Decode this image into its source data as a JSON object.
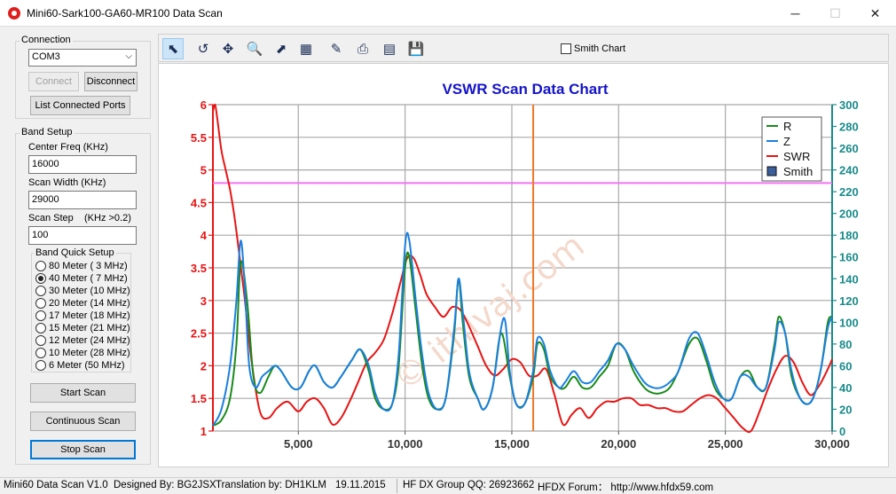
{
  "window": {
    "title": "Mini60-Sark100-GA60-MR100 Data Scan",
    "min_glyph": "─",
    "max_glyph": "☐",
    "close_glyph": "✕"
  },
  "connection": {
    "label": "Connection",
    "port_value": "COM3",
    "connect_label": "Connect",
    "disconnect_label": "Disconnect",
    "list_ports_label": "List Connected Ports"
  },
  "band_setup": {
    "label": "Band Setup",
    "center_freq_label": "Center Freq  (KHz)",
    "center_freq_value": "16000",
    "scan_width_label": "Scan Width   (KHz)",
    "scan_width_value": "29000",
    "scan_step_label": "Scan Step",
    "scan_step_hint": "(KHz >0.2)",
    "scan_step_value": "100",
    "quick_setup_label": "Band Quick Setup",
    "bands": [
      {
        "label": "80 Meter  (  3 MHz)",
        "checked": false
      },
      {
        "label": "40 Meter  (  7 MHz)",
        "checked": true
      },
      {
        "label": "30 Meter  (10 MHz)",
        "checked": false
      },
      {
        "label": "20 Meter  (14 MHz)",
        "checked": false
      },
      {
        "label": "17 Meter  (18 MHz)",
        "checked": false
      },
      {
        "label": "15 Meter  (21 MHz)",
        "checked": false
      },
      {
        "label": "12 Meter  (24 MHz)",
        "checked": false
      },
      {
        "label": "10 Meter  (28 MHz)",
        "checked": false
      },
      {
        "label": "6 Meter   (50 MHz)",
        "checked": false
      }
    ]
  },
  "actions": {
    "start_label": "Start Scan",
    "continuous_label": "Continuous Scan",
    "stop_label": "Stop Scan"
  },
  "toolbar": {
    "tools": [
      {
        "name": "pointer-tool-icon",
        "glyph": "⬉",
        "active": true
      },
      {
        "name": "reset-zoom-icon",
        "glyph": "↺",
        "active": false
      },
      {
        "name": "pan-icon",
        "glyph": "✥",
        "active": false
      },
      {
        "name": "zoom-icon",
        "glyph": "🔍",
        "active": false
      },
      {
        "name": "export-image-icon",
        "glyph": "⬈",
        "active": false
      },
      {
        "name": "chart-settings-icon",
        "glyph": "▦",
        "active": false
      },
      {
        "name": "properties-icon",
        "glyph": "✎",
        "active": false
      },
      {
        "name": "print-icon",
        "glyph": "⎙",
        "active": false
      },
      {
        "name": "print-preview-icon",
        "glyph": "▤",
        "active": false
      },
      {
        "name": "save-icon",
        "glyph": "💾",
        "active": false
      }
    ],
    "smith_chart_label": "Smith Chart"
  },
  "chart_data": {
    "type": "line",
    "title": "VSWR Scan Data Chart",
    "xlim": [
      1000,
      30000
    ],
    "x_ticks": [
      5000,
      10000,
      15000,
      20000,
      25000,
      30000
    ],
    "x_tick_labels": [
      "5,000",
      "10,000",
      "15,000",
      "20,000",
      "25,000",
      "30,000"
    ],
    "y_left_lim": [
      1,
      6
    ],
    "y_left_ticks": [
      1,
      1.5,
      2,
      2.5,
      3,
      3.5,
      4,
      4.5,
      5,
      5.5,
      6
    ],
    "y_right_lim": [
      0,
      300
    ],
    "y_right_ticks": [
      0,
      20,
      40,
      60,
      80,
      100,
      120,
      140,
      160,
      180,
      200,
      220,
      240,
      260,
      280,
      300
    ],
    "grid": true,
    "legend_position": "top-right",
    "legend": [
      "R",
      "Z",
      "SWR",
      "Smith"
    ],
    "colors": {
      "R": "#1a8a1a",
      "Z": "#1a7fe0",
      "SWR": "#e81414",
      "marker": "#f0782a",
      "ref": "#f075f0",
      "left_axis": "#e81414",
      "right_axis": "#1a8a8a",
      "title": "#1414c8"
    },
    "swr_reference": 4.8,
    "marker_x": 16000,
    "watermark": "© ithlvaj.com",
    "series": [
      {
        "name": "R",
        "axis": "right",
        "x": [
          1000,
          1400,
          1800,
          2100,
          2300,
          2600,
          2900,
          3200,
          3600,
          3900,
          4200,
          4700,
          5100,
          5500,
          5800,
          6200,
          6600,
          7000,
          7500,
          7900,
          8300,
          8600,
          9000,
          9400,
          9700,
          10000,
          10200,
          10500,
          10800,
          11100,
          11500,
          11900,
          12300,
          12500,
          12700,
          13000,
          13400,
          13700,
          14100,
          14500,
          14900,
          15200,
          15600,
          16000,
          16200,
          16500,
          16800,
          17200,
          17500,
          17900,
          18300,
          18700,
          19100,
          19500,
          19900,
          20300,
          20700,
          21200,
          21600,
          22000,
          22400,
          22800,
          23300,
          23700,
          24100,
          24500,
          24900,
          25300,
          25700,
          26100,
          26500,
          26900,
          27300,
          27500,
          27800,
          28100,
          28500,
          28900,
          29200,
          29500,
          29800,
          30000
        ],
        "y": [
          5,
          10,
          30,
          80,
          155,
          120,
          50,
          35,
          50,
          60,
          55,
          40,
          40,
          55,
          60,
          45,
          40,
          50,
          65,
          75,
          55,
          30,
          20,
          25,
          60,
          150,
          160,
          110,
          60,
          30,
          20,
          30,
          90,
          140,
          100,
          50,
          30,
          20,
          40,
          90,
          50,
          25,
          25,
          50,
          80,
          75,
          50,
          40,
          40,
          50,
          40,
          40,
          50,
          60,
          80,
          75,
          55,
          40,
          35,
          35,
          40,
          55,
          80,
          85,
          65,
          40,
          30,
          30,
          50,
          55,
          40,
          40,
          80,
          105,
          90,
          50,
          30,
          25,
          35,
          60,
          100,
          105
        ]
      },
      {
        "name": "Z",
        "axis": "right",
        "x": [
          1000,
          1400,
          1800,
          2100,
          2300,
          2500,
          2700,
          3000,
          3300,
          3600,
          3900,
          4200,
          4700,
          5100,
          5500,
          5800,
          6200,
          6600,
          7000,
          7500,
          7900,
          8300,
          8600,
          9000,
          9400,
          9700,
          10000,
          10200,
          10500,
          10800,
          11100,
          11500,
          11900,
          12300,
          12500,
          12700,
          13000,
          13400,
          13700,
          14100,
          14500,
          14700,
          14900,
          15200,
          15600,
          16000,
          16200,
          16500,
          16800,
          17200,
          17500,
          17900,
          18300,
          18700,
          19100,
          19500,
          19900,
          20300,
          20700,
          21200,
          21600,
          22000,
          22400,
          22800,
          23300,
          23700,
          24100,
          24500,
          24900,
          25300,
          25700,
          26100,
          26500,
          26900,
          27300,
          27500,
          27800,
          28100,
          28500,
          28900,
          29200,
          29500,
          29800,
          30000
        ],
        "y": [
          5,
          20,
          60,
          120,
          175,
          130,
          60,
          40,
          50,
          55,
          60,
          55,
          40,
          40,
          55,
          60,
          45,
          40,
          50,
          65,
          75,
          60,
          35,
          20,
          25,
          70,
          170,
          175,
          120,
          70,
          35,
          20,
          30,
          95,
          140,
          110,
          55,
          30,
          20,
          40,
          95,
          100,
          55,
          25,
          25,
          55,
          85,
          80,
          55,
          40,
          45,
          55,
          45,
          45,
          55,
          65,
          80,
          75,
          60,
          45,
          40,
          40,
          45,
          55,
          85,
          90,
          70,
          45,
          30,
          30,
          50,
          50,
          40,
          40,
          75,
          100,
          90,
          55,
          30,
          25,
          35,
          60,
          95,
          105
        ]
      },
      {
        "name": "SWR",
        "axis": "left",
        "x": [
          1000,
          1100,
          1200,
          1400,
          1600,
          1800,
          2000,
          2200,
          2500,
          2800,
          3200,
          3600,
          4000,
          4500,
          5000,
          5400,
          5800,
          6200,
          6600,
          7000,
          7400,
          7800,
          8200,
          8600,
          9000,
          9400,
          9800,
          10100,
          10400,
          10700,
          11000,
          11400,
          11800,
          12200,
          12600,
          13000,
          13400,
          13800,
          14200,
          14600,
          15000,
          15400,
          15800,
          16200,
          16600,
          17000,
          17400,
          17800,
          18200,
          18600,
          19000,
          19400,
          19800,
          20200,
          20600,
          21000,
          21400,
          21800,
          22200,
          22600,
          23000,
          23400,
          23800,
          24200,
          24600,
          25000,
          25400,
          25800,
          26200,
          26600,
          27000,
          27400,
          27800,
          28200,
          28600,
          29000,
          29400,
          29800,
          30000
        ],
        "y": [
          5.9,
          6.0,
          5.8,
          5.3,
          5.0,
          4.7,
          4.3,
          3.8,
          3.0,
          2.1,
          1.3,
          1.2,
          1.35,
          1.45,
          1.3,
          1.45,
          1.5,
          1.35,
          1.1,
          1.2,
          1.45,
          1.75,
          2.05,
          2.2,
          2.4,
          2.8,
          3.3,
          3.65,
          3.65,
          3.4,
          3.1,
          2.9,
          2.75,
          2.9,
          2.85,
          2.6,
          2.3,
          2.0,
          1.85,
          1.95,
          2.1,
          2.05,
          1.85,
          1.85,
          1.95,
          1.55,
          1.1,
          1.25,
          1.35,
          1.2,
          1.35,
          1.45,
          1.45,
          1.5,
          1.5,
          1.4,
          1.4,
          1.35,
          1.35,
          1.3,
          1.3,
          1.4,
          1.5,
          1.55,
          1.5,
          1.35,
          1.2,
          1.05,
          1.0,
          1.3,
          1.65,
          1.95,
          2.15,
          2.05,
          1.75,
          1.55,
          1.7,
          1.95,
          2.1
        ]
      }
    ]
  },
  "status": {
    "version": "Mini60 Data Scan V1.0",
    "designed": "Designed By: BG2JSX",
    "translation": "Translation by: DH1KLM",
    "date": "19.11.2015",
    "group": "HF DX Group QQ: 26923662",
    "forum": "HFDX Forum： http://www.hfdx59.com"
  }
}
